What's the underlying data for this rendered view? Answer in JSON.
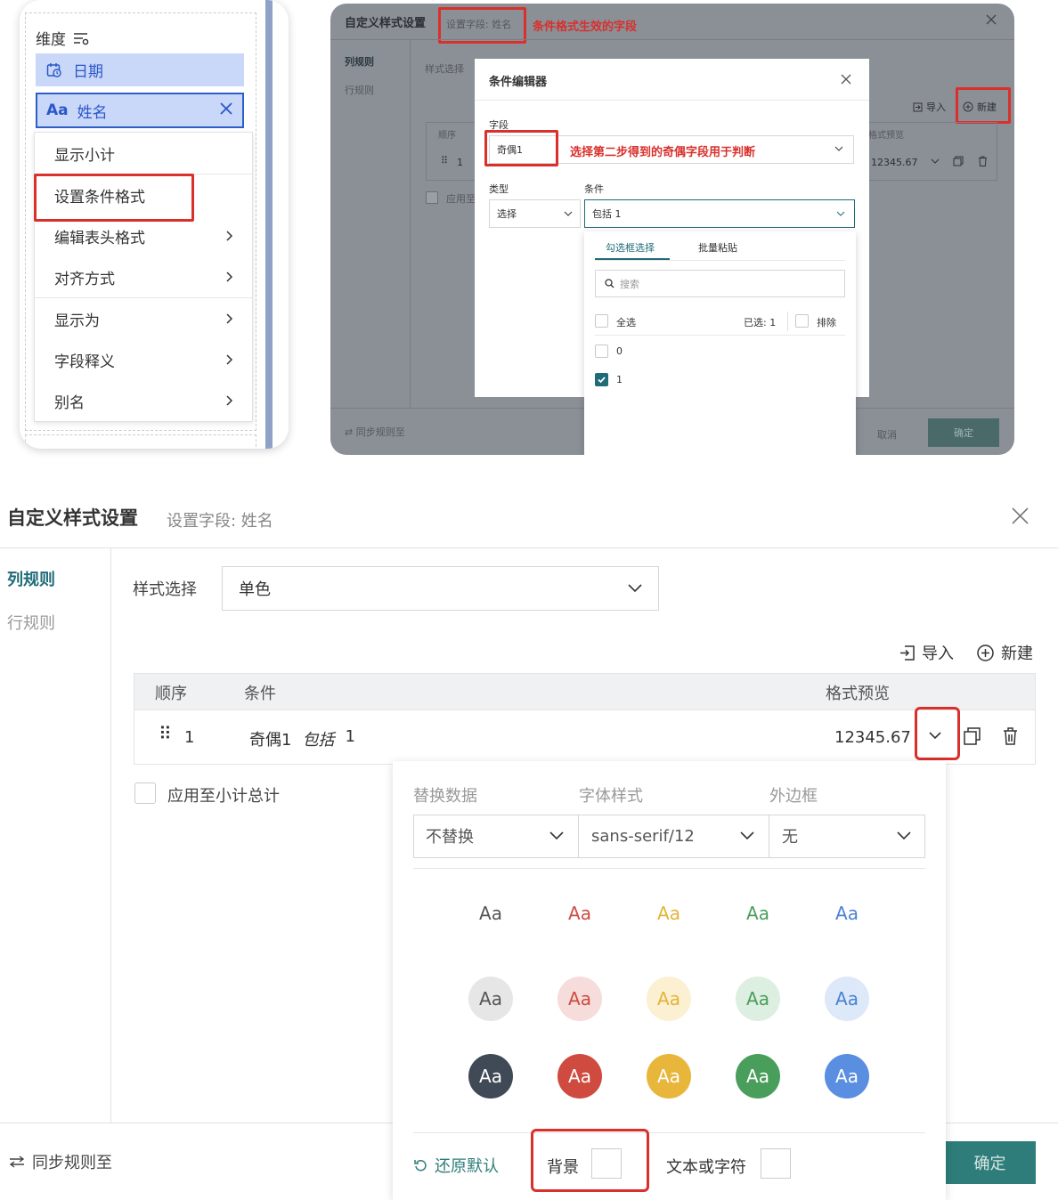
{
  "menu_panel": {
    "dim_title": "维度",
    "field_date": "日期",
    "field_name_icon": "Aa",
    "field_name": "姓名",
    "items": [
      {
        "label": "显示小计",
        "arrow": false
      },
      {
        "label": "设置条件格式",
        "arrow": false
      },
      {
        "label": "编辑表头格式",
        "arrow": true
      },
      {
        "label": "对齐方式",
        "arrow": true
      },
      {
        "label": "显示为",
        "arrow": true
      },
      {
        "label": "字段释义",
        "arrow": true
      },
      {
        "label": "别名",
        "arrow": true
      }
    ]
  },
  "editor_panel": {
    "title": "自定义样式设置",
    "field_tag": "设置字段: 姓名",
    "annotation_field": "条件格式生效的字段",
    "side_tabs": [
      "列规则",
      "行规则"
    ],
    "style_label": "样式选择",
    "import": "导入",
    "new": "新建",
    "table_head_order": "顺序",
    "table_head_preview": "格式预览",
    "row_index": "1",
    "preview_value": "12345.67",
    "apply_label": "应用至",
    "sync": "同步规则至",
    "cancel": "取消",
    "confirm": "确定",
    "dialog": {
      "title": "条件编辑器",
      "field_label": "字段",
      "field_value": "奇偶1",
      "annotation_select": "选择第二步得到的奇偶字段用于判断",
      "type_label": "类型",
      "type_value": "选择",
      "cond_label": "条件",
      "cond_value": "包括 1",
      "tab_check": "勾选框选择",
      "tab_paste": "批量粘贴",
      "search_placeholder": "搜索",
      "select_all": "全选",
      "selected": "已选:",
      "selected_count": "1",
      "exclude": "排除",
      "options": [
        {
          "label": "0",
          "checked": false
        },
        {
          "label": "1",
          "checked": true
        }
      ]
    }
  },
  "settings": {
    "title": "自定义样式设置",
    "field_tag": "设置字段: 姓名",
    "side_tabs": [
      "列规则",
      "行规则"
    ],
    "style_label": "样式选择",
    "style_value": "单色",
    "import": "导入",
    "new": "新建",
    "col_order": "顺序",
    "col_condition": "条件",
    "col_preview": "格式预览",
    "row": {
      "index": "1",
      "field": "奇偶1",
      "op": "包括",
      "value": "1",
      "preview": "12345.67"
    },
    "apply_subtotal": "应用至小计总计",
    "sync": "同步规则至",
    "confirm": "确定",
    "popover": {
      "label_replace": "替换数据",
      "label_font": "字体样式",
      "label_border": "外边框",
      "replace_value": "不替换",
      "font_value": "sans-serif/12",
      "border_value": "无",
      "sample": "Aa",
      "text_colors": [
        "#555555",
        "#cf4b3f",
        "#e3b43a",
        "#4a9e5c",
        "#4a82d4"
      ],
      "light_fills": [
        "#e6e6e6",
        "#f6dcda",
        "#fbf0d2",
        "#dcefe0",
        "#dde8f8"
      ],
      "dark_fills": [
        "#3f4a56",
        "#cf4b3f",
        "#e8b63b",
        "#4a9e5c",
        "#5a8ee0"
      ],
      "reset": "还原默认",
      "background": "背景",
      "text_color": "文本或字符"
    }
  }
}
